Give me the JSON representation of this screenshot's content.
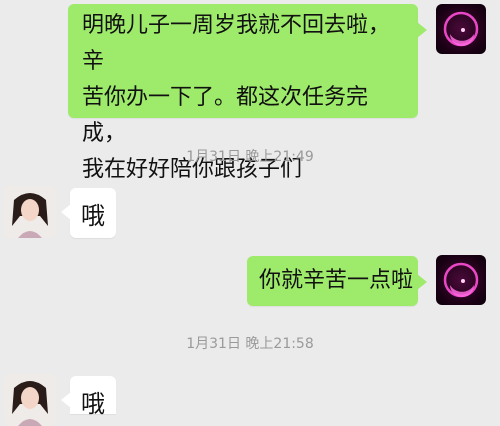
{
  "messages": [
    {
      "text_lines": [
        "明晚儿子一周岁我就不回去啦，辛",
        "苦你办一下了。都这次任务完成，",
        "我在好好陪你跟孩子们"
      ]
    },
    {
      "time": "1月31日 晚上21:49"
    },
    {
      "text": "哦"
    },
    {
      "text": "你就辛苦一点啦"
    },
    {
      "time": "1月31日 晚上21:58"
    },
    {
      "text": "哦"
    }
  ],
  "colors": {
    "sent_bubble": "#9eea6a",
    "received_bubble": "#ffffff",
    "background": "#ebebeb"
  },
  "icons": {
    "self_avatar": "pink-crescent-moon-avatar-icon",
    "other_avatar": "woman-portrait-avatar"
  }
}
